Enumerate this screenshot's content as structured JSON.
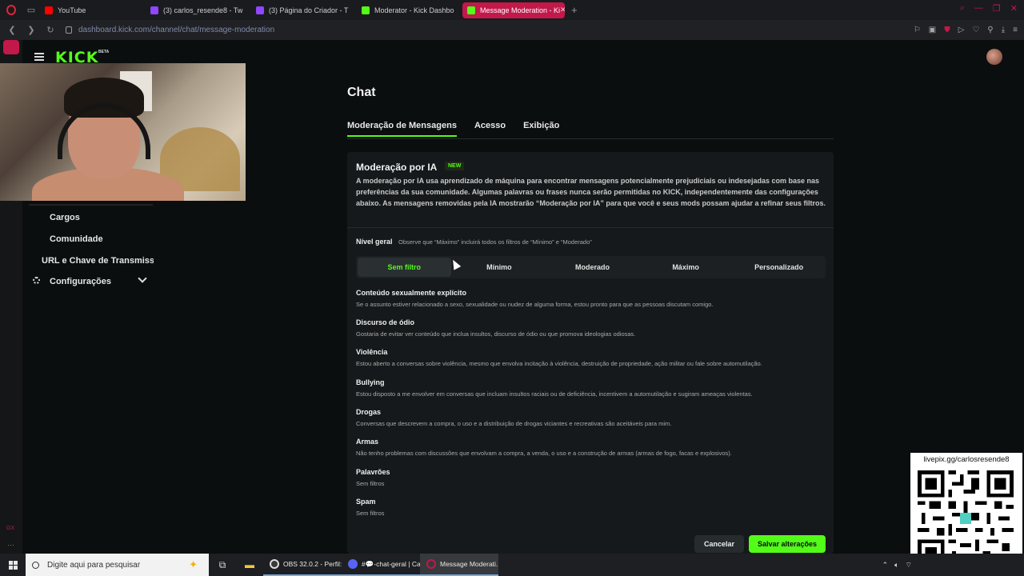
{
  "browser": {
    "tabs": [
      {
        "label": "YouTube",
        "color": "#ff0000"
      },
      {
        "label": "(3) carlos_resende8 - Tw",
        "color": "#9146ff"
      },
      {
        "label": "(3) Página do Criador - T",
        "color": "#9146ff"
      },
      {
        "label": "Moderator - Kick Dashbo",
        "color": "#53fc18"
      },
      {
        "label": "Message Moderation - Ki",
        "color": "#53fc18",
        "active": true
      }
    ],
    "url_host": "dashboard.kick.com",
    "url_path": "/channel/chat/message-moderation"
  },
  "kick": {
    "logo": "KICK",
    "beta": "BETA",
    "nav": {
      "cargos": "Cargos",
      "comunidade": "Comunidade",
      "url_chave": "URL e Chave de Transmissão",
      "configuracoes": "Configurações"
    },
    "page_title": "Chat",
    "tabs": [
      "Moderação de Mensagens",
      "Acesso",
      "Exibição"
    ],
    "ai": {
      "title": "Moderação por IA",
      "badge": "NEW",
      "description": "A moderação por IA usa aprendizado de máquina para encontrar mensagens potencialmente prejudiciais ou indesejadas com base nas preferências da sua comunidade. Algumas palavras ou frases nunca serão permitidas no KICK, independentemente das configurações abaixo. As mensagens removidas pela IA mostrarão “Moderação por IA” para que você e seus mods possam ajudar a refinar seus filtros."
    },
    "level": {
      "label": "Nível geral",
      "hint": "Observe que “Máximo” incluirá todos os filtros de “Mínimo” e “Moderado”",
      "options": [
        "Sem filtro",
        "Mínimo",
        "Moderado",
        "Máximo",
        "Personalizado"
      ],
      "selected": "Sem filtro"
    },
    "filters": [
      {
        "title": "Conteúdo sexualmente explícito",
        "desc": "Se o assunto estiver relacionado a sexo, sexualidade ou nudez de alguma forma, estou pronto para que as pessoas discutam comigo."
      },
      {
        "title": "Discurso de ódio",
        "desc": "Gostaria de evitar ver conteúdo que inclua insultos, discurso de ódio ou que promova ideologias odiosas."
      },
      {
        "title": "Violência",
        "desc": "Estou aberto a conversas sobre violência, mesmo que envolva incitação à violência, destruição de propriedade, ação militar ou fale sobre automutilação."
      },
      {
        "title": "Bullying",
        "desc": "Estou disposto a me envolver em conversas que incluam insultos raciais ou de deficiência, incentivem a automutilação e sugiram ameaças violentas."
      },
      {
        "title": "Drogas",
        "desc": "Conversas que descrevem a compra, o uso e a distribuição de drogas viciantes e recreativas são aceitáveis para mim."
      },
      {
        "title": "Armas",
        "desc": "Não tenho problemas com discussões que envolvam a compra, a venda, o uso e a construção de armas (armas de fogo, facas e explosivos)."
      },
      {
        "title": "Palavrões",
        "desc": "Sem filtros"
      },
      {
        "title": "Spam",
        "desc": "Sem filtros"
      }
    ],
    "buttons": {
      "cancel": "Cancelar",
      "save": "Salvar alterações"
    }
  },
  "overlay": {
    "qr_caption": "livepix.gg/carlosresende8"
  },
  "taskbar": {
    "search_placeholder": "Digite aqui para pesquisar",
    "apps": [
      {
        "label": "OBS 32.0.2 - Perfil: ...",
        "color": "#3a3a3a"
      },
      {
        "label": "#💬-chat-geral | Ca...",
        "color": "#5865f2"
      },
      {
        "label": "Message Moderati...",
        "color": "#c2184a",
        "active": true
      }
    ]
  },
  "colors": {
    "accent": "#53fc18",
    "opera": "#c2184a"
  }
}
